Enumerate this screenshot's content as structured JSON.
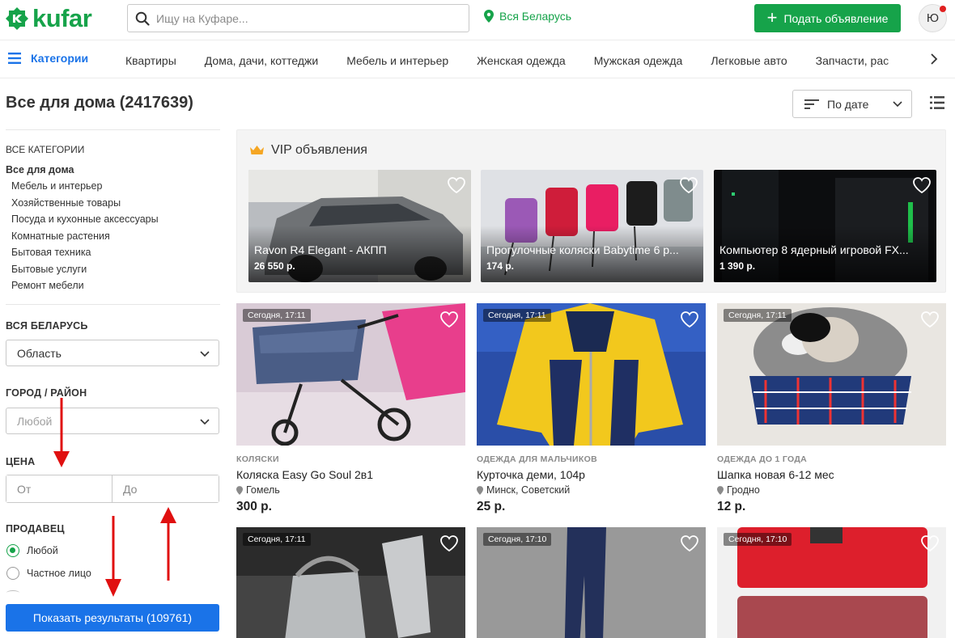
{
  "header": {
    "logo_text": "kufar",
    "search_placeholder": "Ищу на Куфаре...",
    "region": "Вся Беларусь",
    "post_button": "Подать объявление",
    "avatar_letter": "Ю"
  },
  "nav": {
    "menu_label": "Категории",
    "categories": [
      "Квартиры",
      "Дома, дачи, коттеджи",
      "Мебель и интерьер",
      "Женская одежда",
      "Мужская одежда",
      "Легковые авто",
      "Запчасти, рас"
    ]
  },
  "page": {
    "title": "Все для дома (2417639)",
    "sort_label": "По дате"
  },
  "sidebar": {
    "all_categories": "ВСЕ КАТЕГОРИИ",
    "main_category": "Все для дома",
    "subcategories": [
      "Мебель и интерьер",
      "Хозяйственные товары",
      "Посуда и кухонные аксессуары",
      "Комнатные растения",
      "Бытовая техника",
      "Бытовые услуги",
      "Ремонт мебели"
    ],
    "region_heading": "ВСЯ БЕЛАРУСЬ",
    "region_select": "Область",
    "city_heading": "ГОРОД / РАЙОН",
    "city_select": "Любой",
    "price_heading": "ЦЕНА",
    "price_from_placeholder": "От",
    "price_to_placeholder": "До",
    "seller_heading": "ПРОДАВЕЦ",
    "seller_options": [
      "Любой",
      "Частное лицо"
    ],
    "show_button": "Показать результаты (109761)"
  },
  "vip": {
    "heading": "VIP объявления",
    "items": [
      {
        "title": "Ravon R4 Elegant - АКПП",
        "price": "26 550 р."
      },
      {
        "title": "Прогулочные коляски Babytime 6 р...",
        "price": "174 р."
      },
      {
        "title": "Компьютер 8 ядерный игровой FX...",
        "price": "1 390 р."
      }
    ]
  },
  "listings": [
    {
      "time": "Сегодня, 17:11",
      "category": "КОЛЯСКИ",
      "title": "Коляска Easy Go Soul 2в1",
      "location": "Гомель",
      "price": "300 р."
    },
    {
      "time": "Сегодня, 17:11",
      "category": "ОДЕЖДА ДЛЯ МАЛЬЧИКОВ",
      "title": "Курточка деми, 104р",
      "location": "Минск, Советский",
      "price": "25 р."
    },
    {
      "time": "Сегодня, 17:11",
      "category": "ОДЕЖДА ДО 1 ГОДА",
      "title": "Шапка новая 6-12 мес",
      "location": "Гродно",
      "price": "12 р."
    },
    {
      "time": "Сегодня, 17:11"
    },
    {
      "time": "Сегодня, 17:10"
    },
    {
      "time": "Сегодня, 17:10"
    }
  ],
  "colors": {
    "brand_green": "#16a34a",
    "link_blue": "#1a73e8",
    "annotation_red": "#e01010"
  }
}
